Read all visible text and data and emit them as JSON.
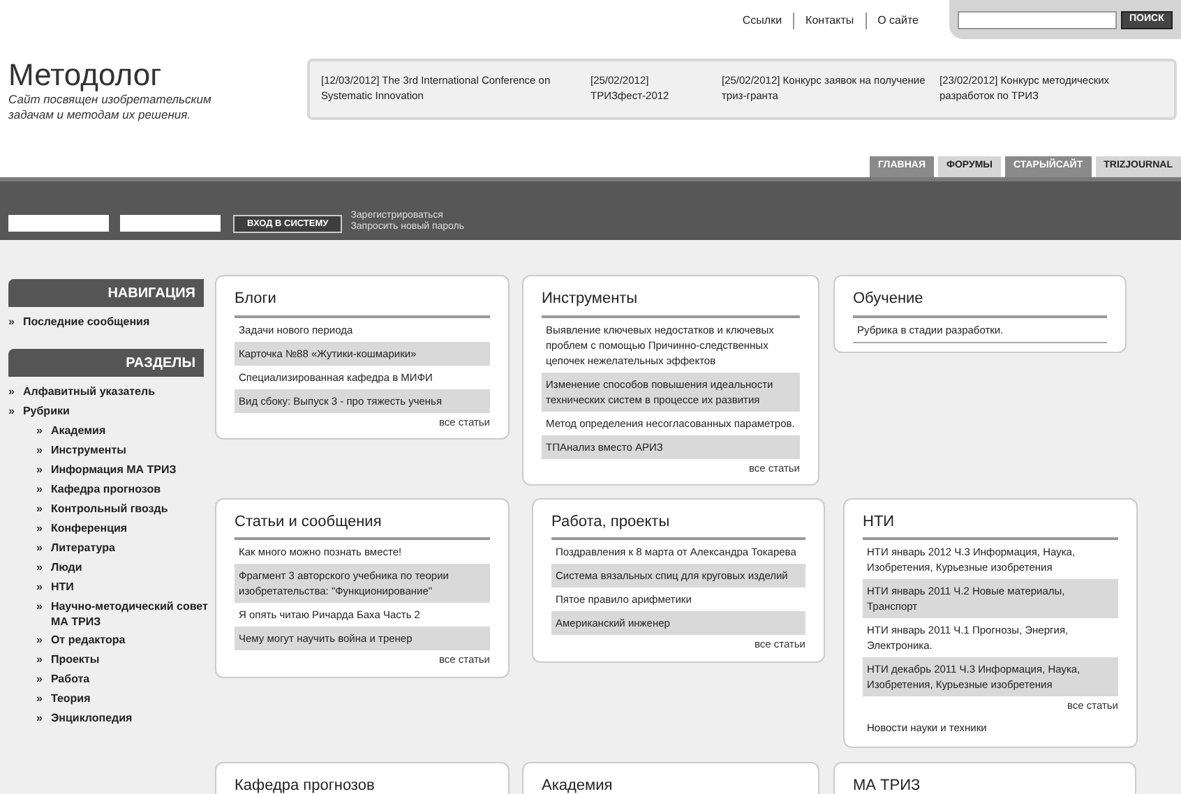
{
  "top_links": [
    "Ссылки",
    "Контакты",
    "О сайте"
  ],
  "search": {
    "button": "ПОИСК"
  },
  "site": {
    "title": "Методолог",
    "tagline": "Сайт посвящен изобретательским задачам и методам их решения."
  },
  "news": [
    {
      "date": "[12/03/2012]",
      "text": "The 3rd International Conference on Systematic Innovation"
    },
    {
      "date": "[25/02/2012]",
      "text": "ТРИЗфест-2012"
    },
    {
      "date": "[25/02/2012]",
      "text": "Конкурс заявок на получение триз-гранта"
    },
    {
      "date": "[23/02/2012]",
      "text": "Конкурс методических разработок по ТРИЗ"
    }
  ],
  "tabs": [
    {
      "label": "ГЛАВНАЯ",
      "kind": "dark"
    },
    {
      "label": "ФОРУМЫ",
      "kind": "light"
    },
    {
      "label": "СТАРЫЙСАЙТ",
      "kind": "dark"
    },
    {
      "label": "TRIZJOURNAL",
      "kind": "light"
    }
  ],
  "login": {
    "button": "ВХОД В СИСТЕМУ",
    "links": [
      "Зарегистрироваться",
      "Запросить новый пароль"
    ]
  },
  "sidebar": {
    "bullet": "»",
    "sections": [
      {
        "title": "НАВИГАЦИЯ",
        "items": [
          {
            "label": "Последние сообщения"
          }
        ]
      },
      {
        "title": "РАЗДЕЛЫ",
        "items": [
          {
            "label": "Алфавитный указатель"
          },
          {
            "label": "Рубрики",
            "children": [
              {
                "label": "Академия"
              },
              {
                "label": "Инструменты"
              },
              {
                "label": "Информация МА ТРИЗ"
              },
              {
                "label": "Кафедра прогнозов"
              },
              {
                "label": "Контрольный гвоздь"
              },
              {
                "label": "Конференция"
              },
              {
                "label": "Литература"
              },
              {
                "label": "Люди"
              },
              {
                "label": "НТИ"
              },
              {
                "label": "Научно-методический совет МА ТРИЗ"
              },
              {
                "label": "От редактора"
              },
              {
                "label": "Проекты"
              },
              {
                "label": "Работа"
              },
              {
                "label": "Теория"
              },
              {
                "label": "Энциклопедия"
              }
            ]
          }
        ]
      }
    ]
  },
  "panel_rows": [
    [
      {
        "title": "Блоги",
        "items": [
          "Задачи нового периода",
          "Карточка №88 «Жутики-кошмарики»",
          "Специализированная кафедра в МИФИ",
          "Вид сбоку: Выпуск 3 - про тяжесть ученья"
        ],
        "more": "все статьи"
      },
      {
        "title": "Инструменты",
        "items": [
          "Выявление ключевых недостатков и ключевых проблем с помощью Причинно-следственных цепочек нежелательных эффектов",
          "Изменение способов повышения идеальности технических систем в процессе их развития",
          "Метод определения несогласованных параметров.",
          "ТПАнализ вместо АРИЗ"
        ],
        "more": "все статьи"
      },
      {
        "title": "Обучение",
        "note": "Рубрика в стадии разработки."
      }
    ],
    [
      {
        "title": "Статьи и сообщения",
        "items": [
          "Как много можно познать вместе!",
          "Фрагмент 3 авторского учебника по теории изобретательства: \"Функционирование\"",
          "Я опять читаю Ричарда Баха Часть 2",
          "Чему могут научить война и тренер"
        ],
        "more": "все статьи"
      },
      {
        "title": "Работа, проекты",
        "items": [
          "Поздравления к 8 марта от Александра Токарева",
          "Система вязальных спиц для круговых изделий",
          "Пятое правило арифметики",
          "Американский инженер"
        ],
        "more": "все статьи"
      },
      {
        "title": "НТИ",
        "items": [
          "НТИ январь 2012 Ч.3 Информация, Наука, Изобретения, Курьезные изобретения",
          "НТИ январь 2011 Ч.2 Новые материалы, Транспорт",
          "НТИ январь 2011 Ч.1 Прогнозы, Энергия, Электроника.",
          "НТИ декабрь 2011 Ч.3 Информация, Наука, Изобретения, Курьезные изобретения"
        ],
        "more": "все статьи",
        "footer": "Новости науки и техники"
      }
    ],
    [
      {
        "title": "Кафедра прогнозов"
      },
      {
        "title": "Академия"
      },
      {
        "title": "МА ТРИЗ"
      }
    ]
  ]
}
